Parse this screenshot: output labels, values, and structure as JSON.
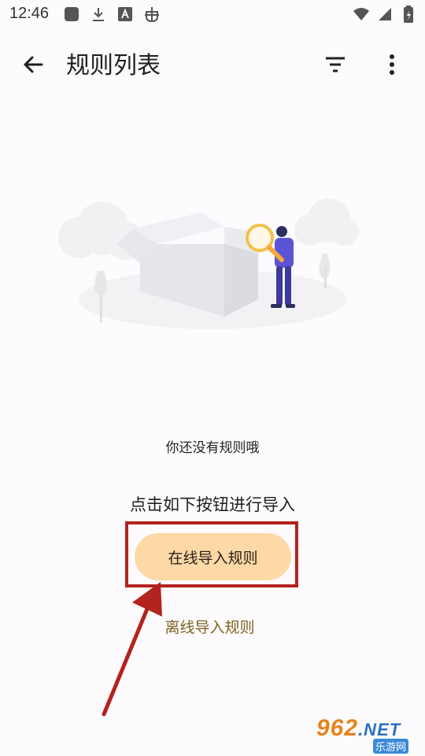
{
  "status_bar": {
    "time": "12:46",
    "left_icons": [
      "square-app-icon",
      "download-icon",
      "font-a-icon",
      "bug-icon"
    ],
    "right_icons": [
      "wifi-icon",
      "signal-icon",
      "battery-icon"
    ]
  },
  "toolbar": {
    "title": "规则列表",
    "back_icon": "arrow-left-icon",
    "filter_icon": "filter-icon",
    "more_icon": "more-vertical-icon"
  },
  "empty_state": {
    "illustration": "empty-box-with-person-magnifier",
    "message": "你还没有规则哦",
    "hint": "点击如下按钮进行导入"
  },
  "actions": {
    "online_label": "在线导入规则",
    "offline_label": "离线导入规则"
  },
  "watermark": {
    "main": "962",
    "suffix": ".NET",
    "sub": "乐游网"
  },
  "colors": {
    "background": "#fdfbfd",
    "online_button": "#fdd9a7",
    "offline_link": "#7c6420",
    "annotation_red": "#b3231f"
  }
}
